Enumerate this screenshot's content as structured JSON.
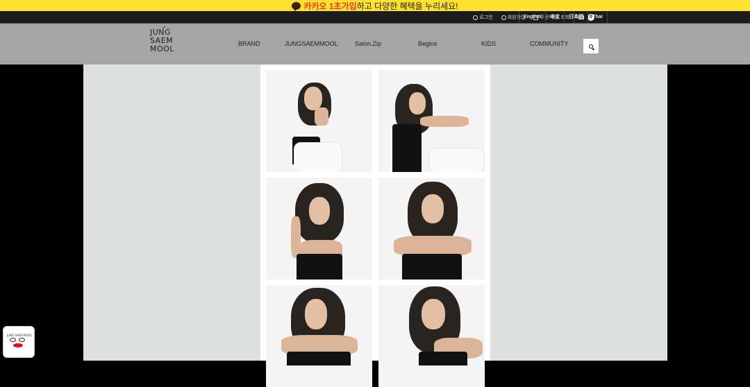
{
  "promo": {
    "highlight": "카카오 1초가입",
    "text": "하고 다양한 혜택을 누리세요!"
  },
  "util": {
    "login": "로그인",
    "join": "회원가입",
    "orders": "주문/배송 조회",
    "cart_count": "0"
  },
  "languages": [
    "English",
    "中文",
    "日本語",
    "Thai"
  ],
  "logo": {
    "line1": "JUNG",
    "line2": "SAEM",
    "line3": "MOOL"
  },
  "menu": [
    "BRAND",
    "JUNGSAEMMOOL",
    "Salon.Zip",
    "Begins",
    "KIDS",
    "COMMUNITY"
  ],
  "badge": {
    "text": "JUNG SAEM MOOL"
  },
  "icons": {
    "search": "search-icon",
    "cart": "cart-icon",
    "chat": "kakao-chat-icon"
  },
  "colors": {
    "promo_bg": "#fde130",
    "highlight": "#e53922",
    "nav_bg": "#a5a5a5"
  }
}
